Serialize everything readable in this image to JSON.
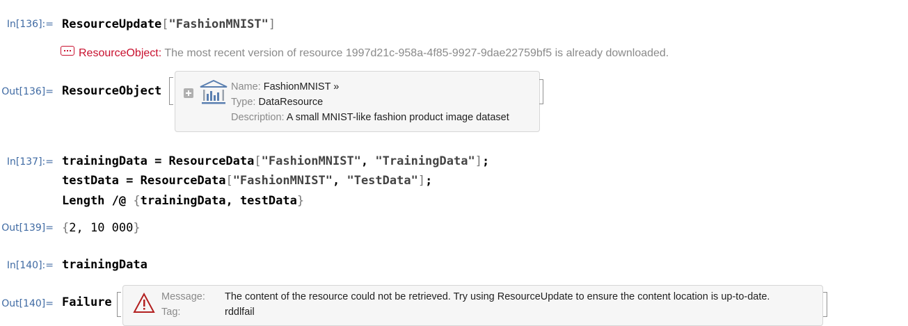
{
  "cells": {
    "in136": {
      "label": "In[136]:=",
      "func": "ResourceUpdate",
      "arg": "\"FashionMNIST\""
    },
    "message": {
      "head": "ResourceObject:",
      "text": "The most recent version of resource 1997d21c-958a-4f85-9927-9dae22759bf5 is already downloaded."
    },
    "out136": {
      "label": "Out[136]=",
      "head": "ResourceObject",
      "name_key": "Name:",
      "name_value": "FashionMNIST »",
      "type_key": "Type:",
      "type_value": "DataResource",
      "desc_key": "Description:",
      "desc_value": "A small MNIST-like fashion product image dataset"
    },
    "in137": {
      "label": "In[137]:=",
      "line1_var": "trainingData",
      "line1_func": "ResourceData",
      "line1_arg1": "\"FashionMNIST\"",
      "line1_arg2": "\"TrainingData\"",
      "line2_var": "testData",
      "line2_func": "ResourceData",
      "line2_arg1": "\"FashionMNIST\"",
      "line2_arg2": "\"TestData\"",
      "line3_func": "Length",
      "line3_op": "/@",
      "line3_list": "trainingData, testData"
    },
    "out139": {
      "label": "Out[139]=",
      "value": "2, 10 000"
    },
    "in140": {
      "label": "In[140]:=",
      "code": "trainingData"
    },
    "out140": {
      "label": "Out[140]=",
      "head": "Failure",
      "message_key": "Message:",
      "message_value": "The content of the resource could not be retrieved. Try using ResourceUpdate to ensure the content location is up-to-date.",
      "tag_key": "Tag:",
      "tag_value": "rddlfail"
    }
  },
  "colors": {
    "label": "#3f6aa3",
    "error": "#c8102e",
    "muted": "#8a8a8a",
    "panel": "#f6f6f6"
  }
}
